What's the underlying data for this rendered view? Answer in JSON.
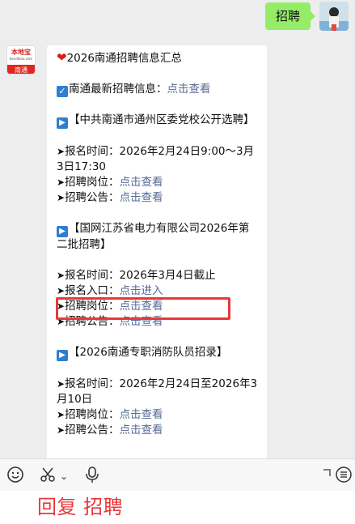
{
  "outgoing_message": "招聘",
  "bot_avatar": {
    "logo_text": "本地宝",
    "logo_sub": "bendibao.com",
    "city": "南通"
  },
  "message": {
    "title": "2026南通招聘信息汇总",
    "latest": {
      "label": "南通最新招聘信息：",
      "link": "点击查看"
    },
    "jobs": [
      {
        "title": "【中共南通市通州区委党校公开选聘】",
        "lines": [
          {
            "label": "报名时间：2026年2月24日9:00～3月3日17:30",
            "link": ""
          },
          {
            "label": "招聘岗位：",
            "link": "点击查看"
          },
          {
            "label": "招聘公告：",
            "link": "点击查看"
          }
        ]
      },
      {
        "title": "【国网江苏省电力有限公司2026年第二批招聘】",
        "lines": [
          {
            "label": "报名时间：2026年3月4日截止",
            "link": ""
          },
          {
            "label": "报名入口：",
            "link": "点击进入"
          },
          {
            "label": "招聘岗位：",
            "link": "点击查看"
          },
          {
            "label": "招聘公告：",
            "link": "点击查看"
          }
        ]
      },
      {
        "title": "【2026南通专职消防队员招录】",
        "lines": [
          {
            "label": "报名时间：2026年2月24日至2026年3月10日",
            "link": ""
          },
          {
            "label": "招聘岗位：",
            "link": "点击查看"
          },
          {
            "label": "招聘公告：",
            "link": "点击查看"
          }
        ]
      }
    ]
  },
  "toolbar": {
    "icons": [
      "emoji-icon",
      "scissors-icon",
      "chevron-down-icon",
      "microphone-icon",
      "expand-icon",
      "menu-icon"
    ]
  },
  "caption": "回复 招聘",
  "colors": {
    "bubble_green": "#95ec69",
    "link": "#576b95",
    "highlight_red": "#e8383a"
  }
}
